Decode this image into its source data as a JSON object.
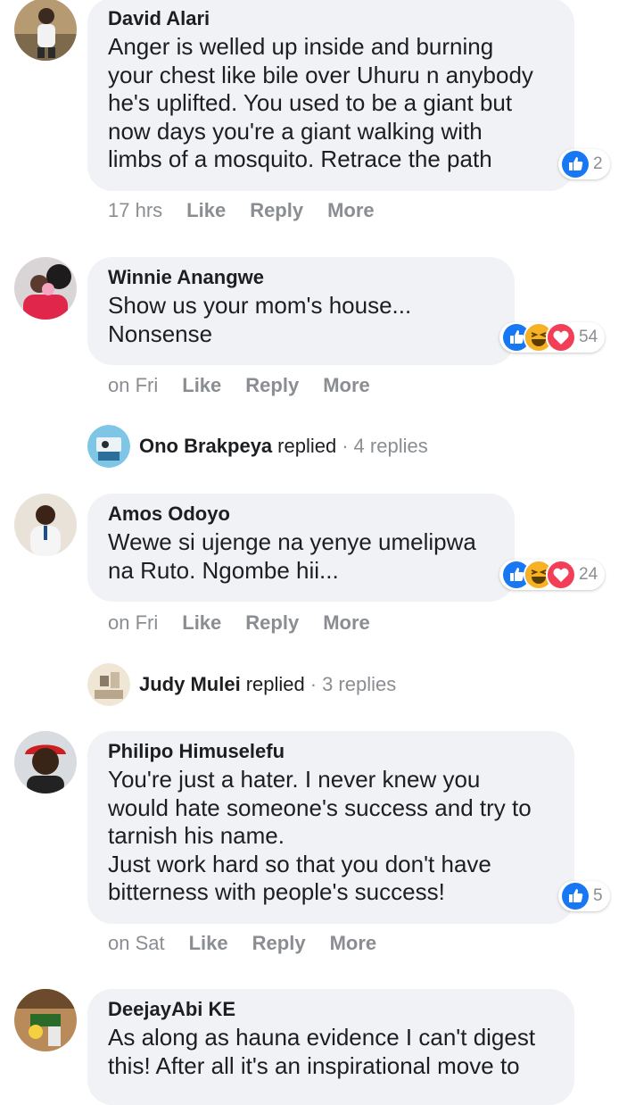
{
  "comments": [
    {
      "author": "David Alari",
      "text": "Anger is welled up inside and burning\nyour chest like bile over Uhuru n anybody\nhe's uplifted. You used to be a giant but\nnow days you're a giant walking with\nlimbs of a mosquito. Retrace the path",
      "time": "17 hrs",
      "like": "Like",
      "reply": "Reply",
      "more": "More",
      "reactions": [
        "like"
      ],
      "reaction_count": "2"
    },
    {
      "author": "Winnie Anangwe",
      "text": "Show us your mom's house...\nNonsense",
      "time": "on Fri",
      "like": "Like",
      "reply": "Reply",
      "more": "More",
      "reactions": [
        "like",
        "haha",
        "love"
      ],
      "reaction_count": "54",
      "replied": {
        "name": "Ono Brakpeya",
        "verb": "replied",
        "sep": "·",
        "count": "4 replies"
      }
    },
    {
      "author": "Amos Odoyo",
      "text": "Wewe si ujenge na yenye umelipwa\nna Ruto. Ngombe hii...",
      "time": "on Fri",
      "like": "Like",
      "reply": "Reply",
      "more": "More",
      "reactions": [
        "like",
        "haha",
        "love"
      ],
      "reaction_count": "24",
      "replied": {
        "name": "Judy Mulei",
        "verb": "replied",
        "sep": "·",
        "count": "3 replies"
      }
    },
    {
      "author": "Philipo Himuselefu",
      "text": "You're just a hater. I never knew you\nwould hate someone's success and try to\ntarnish his name.\nJust work hard so that you don't have\nbitterness with people's success!",
      "time": "on Sat",
      "like": "Like",
      "reply": "Reply",
      "more": "More",
      "reactions": [
        "like"
      ],
      "reaction_count": "5"
    },
    {
      "author": "DeejayAbi KE",
      "text": "As along as hauna evidence I can't digest\nthis! After all it's an inspirational move to"
    }
  ],
  "colors": {
    "like": "#1877f2",
    "love": "#f33e58",
    "haha": "#f7b125",
    "bubble": "#f0f2f5",
    "meta": "#8a8d91"
  }
}
